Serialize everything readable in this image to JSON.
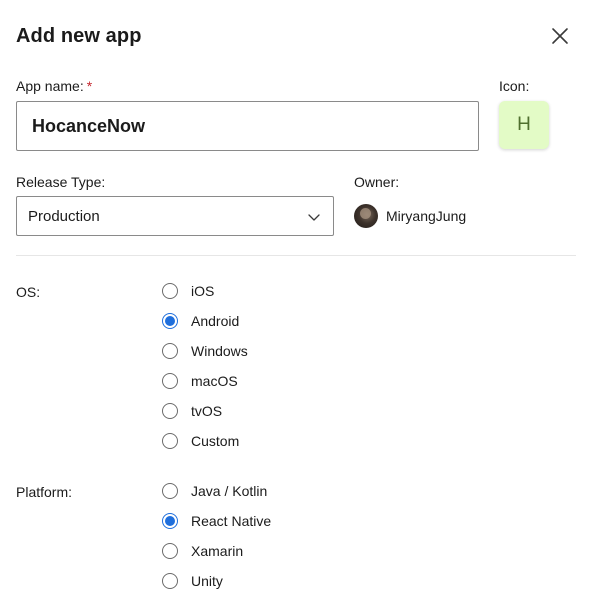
{
  "dialog": {
    "title": "Add new app",
    "close_icon": "close-icon"
  },
  "app_name": {
    "label": "App name:",
    "required_marker": "*",
    "value": "HocanceNow"
  },
  "icon": {
    "label": "Icon:",
    "letter": "H",
    "background_color": "#e3fbc6"
  },
  "release_type": {
    "label": "Release Type:",
    "selected": "Production",
    "chevron_icon": "chevron-down-icon"
  },
  "owner": {
    "label": "Owner:",
    "name": "MiryangJung",
    "avatar_icon": "avatar"
  },
  "os": {
    "label": "OS:",
    "options": [
      "iOS",
      "Android",
      "Windows",
      "macOS",
      "tvOS",
      "Custom"
    ],
    "selected": "Android"
  },
  "platform": {
    "label": "Platform:",
    "options": [
      "Java / Kotlin",
      "React Native",
      "Xamarin",
      "Unity"
    ],
    "selected": "React Native"
  },
  "colors": {
    "accent": "#1f6fdc",
    "required": "#c4262e"
  }
}
